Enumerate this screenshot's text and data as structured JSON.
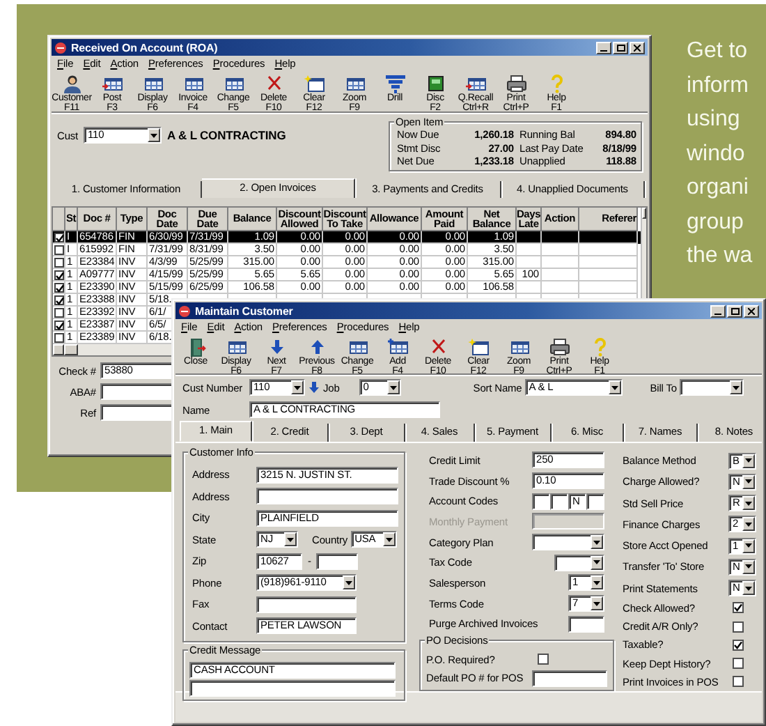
{
  "promo_text_lines": [
    "Get to",
    "inform",
    "using",
    "windo",
    "organi",
    "group",
    "the wa"
  ],
  "roa_window": {
    "title": "Received On Account (ROA)",
    "menu": [
      "File",
      "Edit",
      "Action",
      "Preferences",
      "Procedures",
      "Help"
    ],
    "toolbar": [
      {
        "kind": "person",
        "label": "Customer",
        "key": "F11"
      },
      {
        "kind": "table_arrow",
        "label": "Post",
        "key": "F3"
      },
      {
        "kind": "table",
        "label": "Display",
        "key": "F6"
      },
      {
        "kind": "table",
        "label": "Invoice",
        "key": "F4"
      },
      {
        "kind": "table",
        "label": "Change",
        "key": "F5"
      },
      {
        "kind": "delete",
        "label": "Delete",
        "key": "F10"
      },
      {
        "kind": "window",
        "label": "Clear",
        "key": "F12"
      },
      {
        "kind": "table",
        "label": "Zoom",
        "key": "F9"
      },
      {
        "kind": "funnel",
        "label": "Drill"
      },
      {
        "kind": "screen",
        "label": "Disc",
        "key": "F2"
      },
      {
        "kind": "table_arrow",
        "label": "Q.Recall",
        "key": "Ctrl+R"
      },
      {
        "kind": "printer",
        "label": "Print",
        "key": "Ctrl+P"
      },
      {
        "kind": "help",
        "label": "Help",
        "key": "F1"
      }
    ],
    "customer": {
      "label": "Cust",
      "value": "110",
      "name": "A & L CONTRACTING"
    },
    "open_item": {
      "title": "Open Item",
      "rows": [
        {
          "label": "Now Due",
          "value": "1,260.18",
          "label_2": "Running Bal",
          "value_2": "894.80"
        },
        {
          "label": "Stmt Disc",
          "value": "27.00",
          "label_2": "Last Pay Date",
          "value_2": "8/18/99"
        },
        {
          "label": "Net Due",
          "value": "1,233.18",
          "label_2": "Unapplied",
          "value_2": "118.88"
        }
      ]
    },
    "tabs": [
      {
        "label": "1. Customer Information",
        "selected": false
      },
      {
        "label": "2. Open Invoices",
        "selected": true
      },
      {
        "label": "3. Payments and Credits",
        "selected": false
      },
      {
        "label": "4. Unapplied Documents",
        "selected": false
      }
    ],
    "table": {
      "columns": [
        "St",
        "Doc #",
        "Type",
        "Doc Date",
        "Due Date",
        "Balance",
        "Discount Allowed",
        "Discount To Take",
        "Allowance",
        "Amount Paid",
        "Net Balance",
        "Days Late",
        "Action",
        "Referer"
      ],
      "rows": [
        {
          "checked": true,
          "selected": true,
          "cells": [
            "I",
            "654786",
            "FIN",
            "6/30/99",
            "7/31/99",
            "1.09",
            "0.00",
            "0.00",
            "0.00",
            "0.00",
            "1.09"
          ]
        },
        {
          "checked": false,
          "selected": false,
          "cells": [
            "I",
            "615992",
            "FIN",
            "7/31/99",
            "8/31/99",
            "3.50",
            "0.00",
            "0.00",
            "0.00",
            "0.00",
            "3.50"
          ]
        },
        {
          "checked": false,
          "selected": false,
          "cells": [
            "1",
            "E23384",
            "INV",
            "4/3/99",
            "5/25/99",
            "315.00",
            "0.00",
            "0.00",
            "0.00",
            "0.00",
            "315.00"
          ]
        },
        {
          "checked": true,
          "selected": false,
          "cells": [
            "1",
            "A09777",
            "INV",
            "4/15/99",
            "5/25/99",
            "5.65",
            "5.65",
            "0.00",
            "0.00",
            "0.00",
            "5.65",
            "100"
          ]
        },
        {
          "checked": true,
          "selected": false,
          "cells": [
            "1",
            "E23390",
            "INV",
            "5/15/99",
            "6/25/99",
            "106.58",
            "0.00",
            "0.00",
            "0.00",
            "0.00",
            "106.58"
          ]
        },
        {
          "checked": true,
          "selected": false,
          "cells": [
            "1",
            "E23388",
            "INV",
            "5/18."
          ]
        },
        {
          "checked": false,
          "selected": false,
          "cells": [
            "1",
            "E23392",
            "INV",
            "6/1/"
          ]
        },
        {
          "checked": true,
          "selected": false,
          "cells": [
            "1",
            "E23387",
            "INV",
            "6/5/"
          ]
        },
        {
          "checked": false,
          "selected": false,
          "cells": [
            "1",
            "E23389",
            "INV",
            "6/18."
          ]
        }
      ]
    },
    "fields": [
      {
        "label": "Check #",
        "value": "53880"
      },
      {
        "label": "ABA#"
      },
      {
        "label": "Ref"
      }
    ]
  },
  "maintain_window": {
    "title": "Maintain Customer",
    "menu": [
      "File",
      "Edit",
      "Action",
      "Preferences",
      "Procedures",
      "Help"
    ],
    "toolbar": [
      {
        "kind": "door",
        "label": "Close"
      },
      {
        "kind": "table",
        "label": "Display",
        "key": "F6"
      },
      {
        "kind": "arrow_down",
        "label": "Next",
        "key": "F7"
      },
      {
        "kind": "arrow_up",
        "label": "Previous",
        "key": "F8"
      },
      {
        "kind": "table",
        "label": "Change",
        "key": "F5"
      },
      {
        "kind": "table_add",
        "label": "Add",
        "key": "F4"
      },
      {
        "kind": "delete",
        "label": "Delete",
        "key": "F10"
      },
      {
        "kind": "window",
        "label": "Clear",
        "key": "F12"
      },
      {
        "kind": "table",
        "label": "Zoom",
        "key": "F9"
      },
      {
        "kind": "printer",
        "label": "Print",
        "key": "Ctrl+P"
      },
      {
        "kind": "help",
        "label": "Help",
        "key": "F1"
      }
    ],
    "cust_number": {
      "label": "Cust Number",
      "value": "110"
    },
    "job": {
      "label": "Job",
      "value": "0"
    },
    "sort_name": {
      "label": "Sort Name",
      "value": "A & L"
    },
    "bill_to": {
      "label": "Bill To"
    },
    "name": {
      "label": "Name",
      "value": "A & L CONTRACTING"
    },
    "tabs": [
      {
        "label": "1. Main",
        "selected": true
      },
      {
        "label": "2. Credit",
        "selected": false
      },
      {
        "label": "3. Dept",
        "selected": false
      },
      {
        "label": "4. Sales",
        "selected": false
      },
      {
        "label": "5. Payment",
        "selected": false
      },
      {
        "label": "6. Misc",
        "selected": false
      },
      {
        "label": "7. Names",
        "selected": false
      },
      {
        "label": "8. Notes",
        "selected": false
      }
    ],
    "customer_info": {
      "title": "Customer Info",
      "address_1": {
        "label": "Address",
        "value": "3215 N. JUSTIN ST."
      },
      "address_2": {
        "label": "Address"
      },
      "city": {
        "label": "City",
        "value": "PLAINFIELD"
      },
      "state": {
        "label": "State",
        "value": "NJ"
      },
      "country": {
        "label": "Country",
        "value": "USA"
      },
      "zip": {
        "label": "Zip",
        "value": "10627",
        "separator": "-"
      },
      "phone": {
        "label": "Phone",
        "value": "(918)961-9110"
      },
      "fax": {
        "label": "Fax"
      },
      "contact": {
        "label": "Contact",
        "value": "PETER LAWSON"
      }
    },
    "credit_message": {
      "title": "Credit Message",
      "lines": [
        {
          "kind": "text",
          "value": "CASH ACCOUNT"
        },
        {
          "kind": "blank"
        }
      ]
    },
    "middle_fields": [
      {
        "kind": "text",
        "label": "Credit Limit",
        "value": "250",
        "disabled": false
      },
      {
        "kind": "text",
        "label": "Trade Discount %",
        "value": "0.10",
        "disabled": false
      },
      {
        "kind": "codes",
        "label": "Account Codes",
        "codes": [
          {
            "kind": "blank"
          },
          {
            "kind": "blank"
          },
          {
            "kind": "text",
            "value": "N"
          },
          {
            "kind": "blank"
          }
        ]
      },
      {
        "kind": "text",
        "label": "Monthly Payment",
        "disabled": true
      },
      {
        "kind": "dropdown",
        "label": "Category Plan"
      },
      {
        "kind": "short_dropdown",
        "label": "Tax Code"
      },
      {
        "kind": "short_dropdown",
        "label": "Salesperson",
        "value": "1"
      },
      {
        "kind": "short_dropdown",
        "label": "Terms Code",
        "value": "7"
      },
      {
        "kind": "short_text",
        "label": "Purge Archived Invoices"
      }
    ],
    "po_decisions": {
      "title": "PO Decisions",
      "po_required": {
        "label": "P.O. Required?",
        "checked": false
      },
      "default_po": {
        "label": "Default PO # for POS"
      }
    },
    "right_fields": [
      {
        "kind": "dropdown",
        "label": "Balance Method",
        "value": "B"
      },
      {
        "kind": "dropdown",
        "label": "Charge  Allowed?",
        "value": "N"
      },
      {
        "kind": "dropdown",
        "label": "Std Sell Price",
        "value": "R"
      },
      {
        "kind": "dropdown",
        "label": "Finance Charges",
        "value": "2"
      },
      {
        "kind": "dropdown",
        "label": "Store Acct Opened",
        "value": "1"
      },
      {
        "kind": "dropdown",
        "label": "Transfer 'To' Store",
        "value": "N"
      },
      {
        "kind": "dropdown",
        "label": "Print Statements",
        "value": "N"
      },
      {
        "kind": "checkbox",
        "label": "Check Allowed?",
        "checked": true
      },
      {
        "kind": "checkbox",
        "label": "Credit A/R Only?",
        "checked": false
      },
      {
        "kind": "checkbox",
        "label": "Taxable?",
        "checked": true
      },
      {
        "kind": "checkbox",
        "label": "Keep Dept History?",
        "checked": false
      },
      {
        "kind": "checkbox",
        "label": "Print Invoices in POS",
        "checked": false
      }
    ]
  }
}
